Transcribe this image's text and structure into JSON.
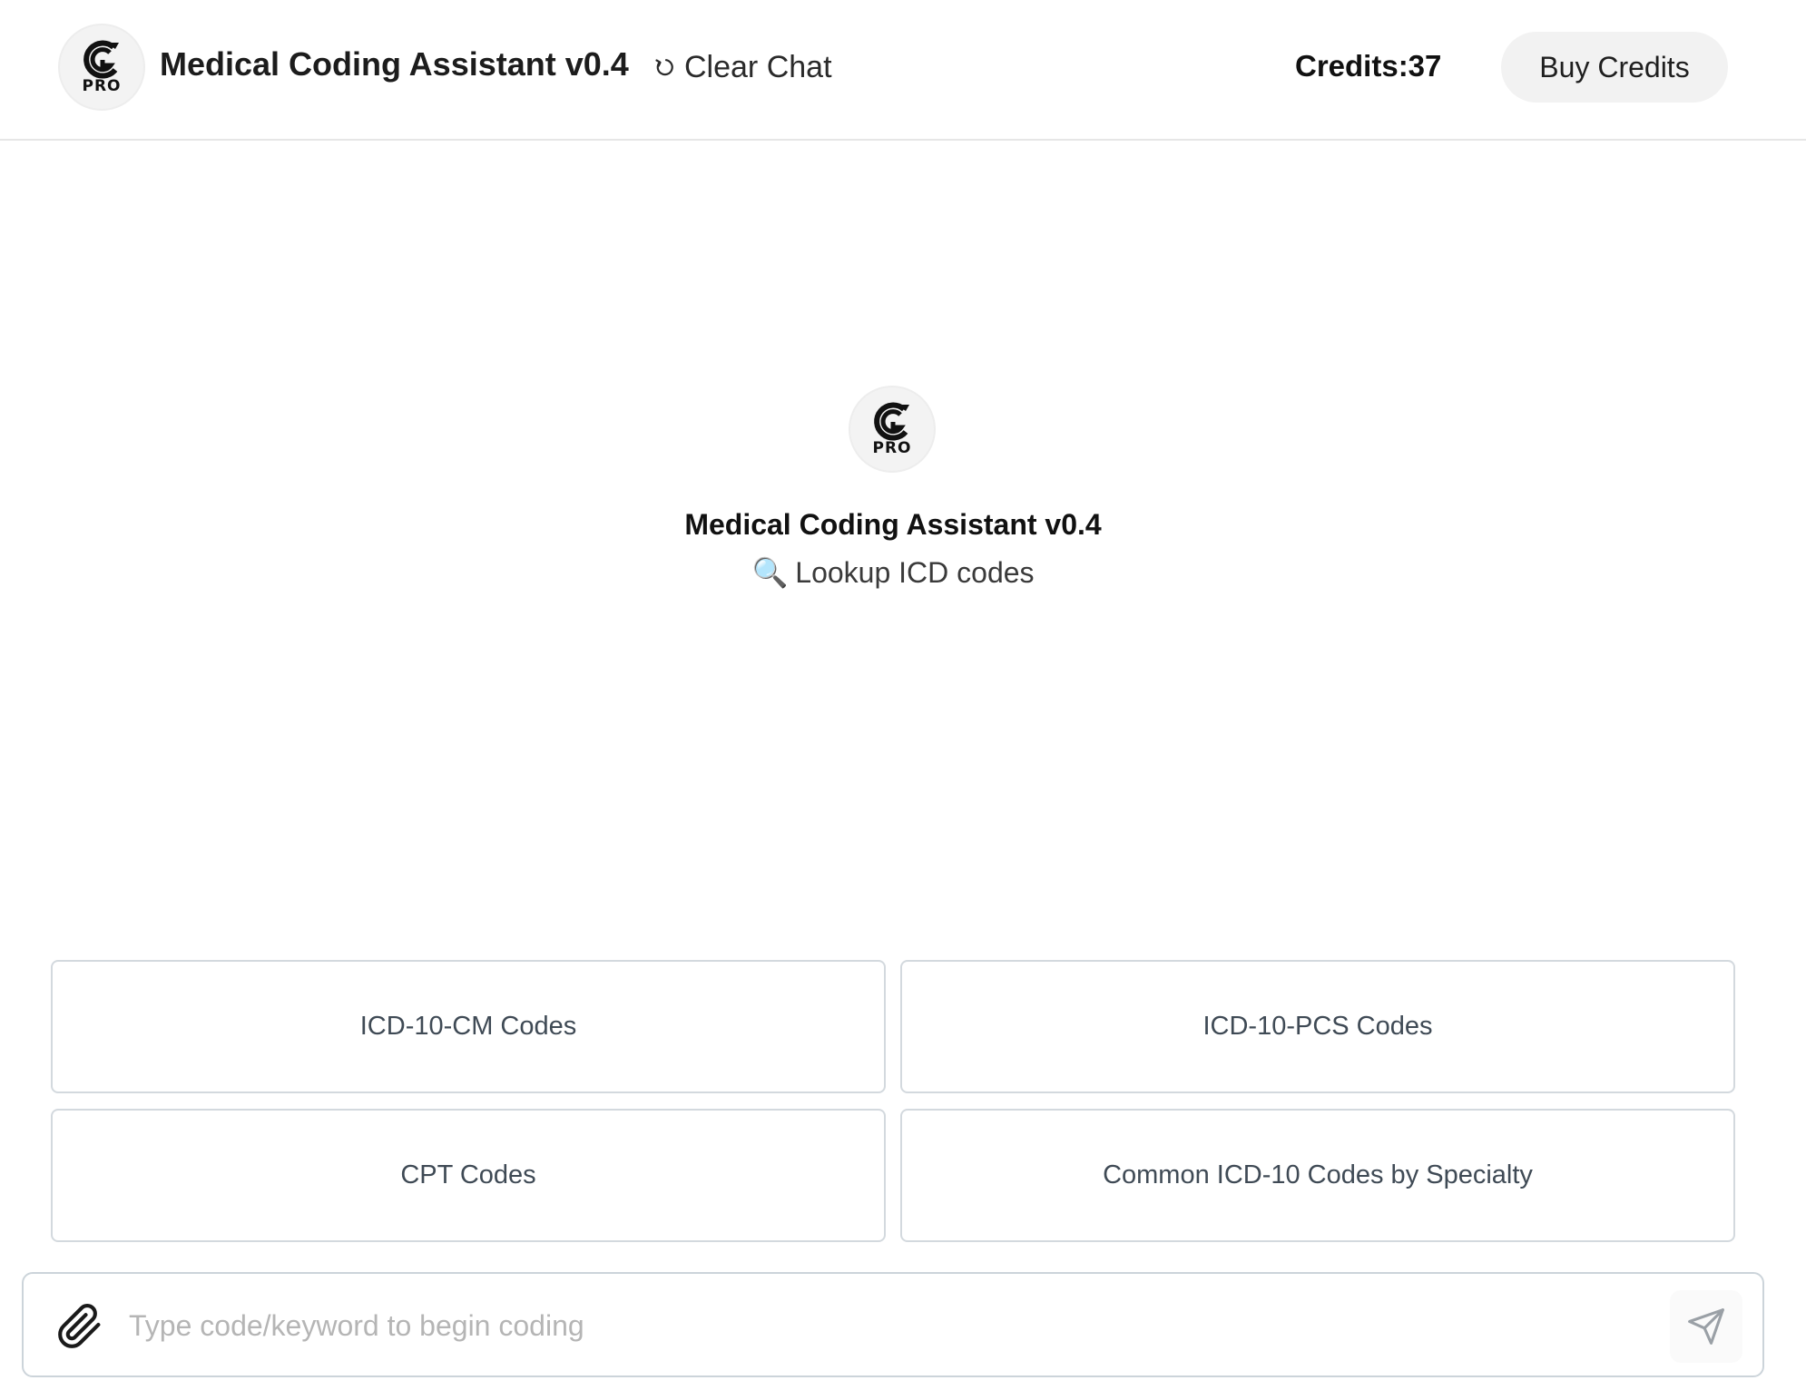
{
  "header": {
    "logo_text": "PRO",
    "title": "Medical Coding Assistant v0.4",
    "clear_chat_label": "Clear Chat",
    "credits_label": "Credits:37",
    "buy_credits_label": "Buy Credits"
  },
  "intro": {
    "logo_text": "PRO",
    "title": "Medical Coding Assistant v0.4",
    "subtitle_icon": "🔍",
    "subtitle": "Lookup ICD codes"
  },
  "suggestions": [
    {
      "label": "ICD-10-CM Codes"
    },
    {
      "label": "ICD-10-PCS Codes"
    },
    {
      "label": "CPT Codes"
    },
    {
      "label": "Common ICD-10 Codes by Specialty"
    }
  ],
  "composer": {
    "placeholder": "Type code/keyword to begin coding",
    "value": ""
  },
  "icons": {
    "logo": "pro-logo-icon",
    "clear": "refresh-icon",
    "attach": "paperclip-icon",
    "send": "send-icon"
  },
  "colors": {
    "card_border": "#d3d9de",
    "card_text": "#3f4a55",
    "button_bg": "#f2f2f2",
    "placeholder": "#b5b5b5"
  }
}
